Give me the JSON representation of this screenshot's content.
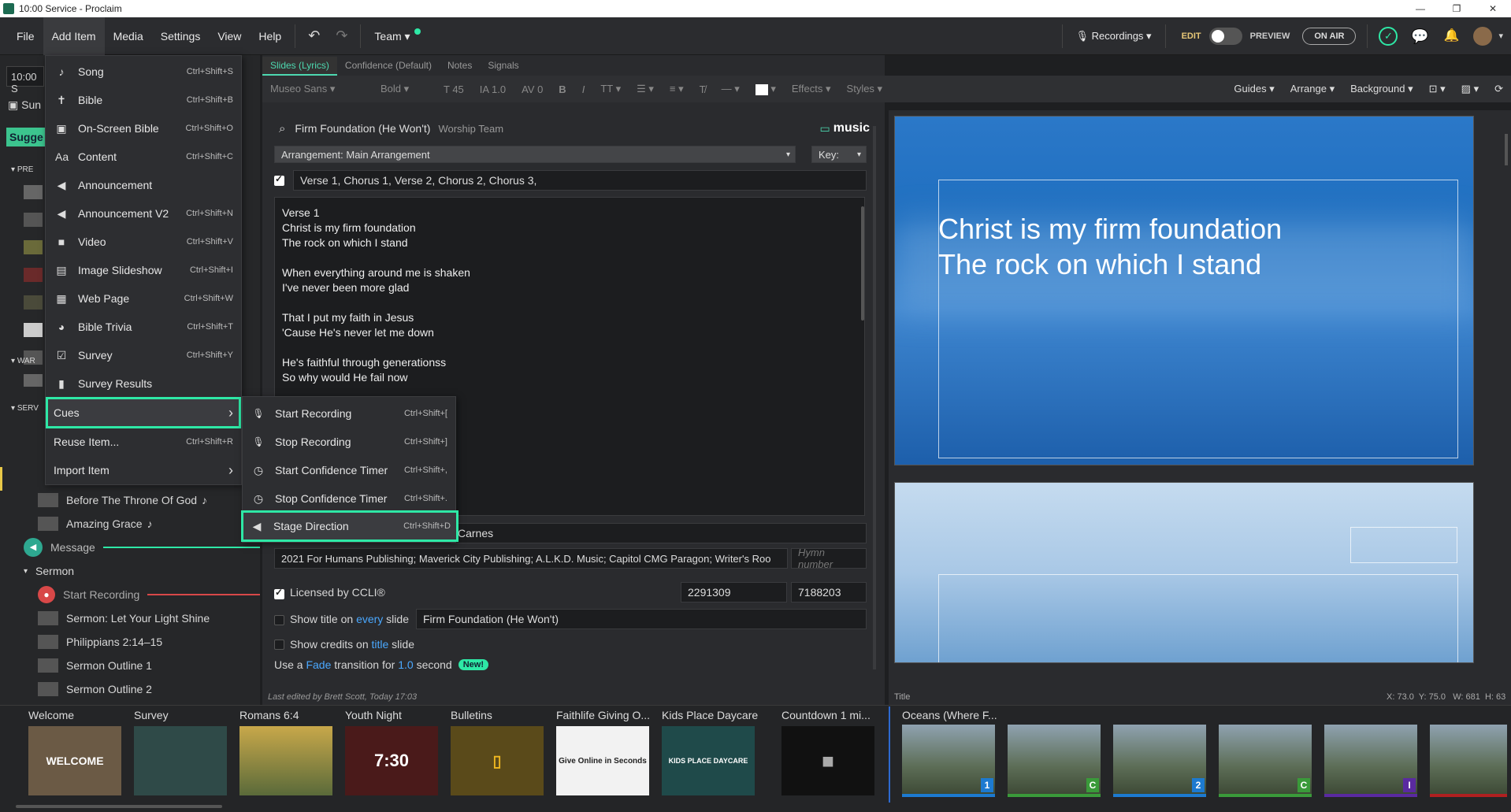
{
  "window": {
    "title": "10:00 Service - Proclaim"
  },
  "menubar": {
    "items": [
      "File",
      "Add Item",
      "Media",
      "Settings",
      "View",
      "Help"
    ],
    "team_label": "Team",
    "recordings_label": "Recordings",
    "edit_label": "EDIT",
    "preview_label": "PREVIEW",
    "on_air_label": "ON AIR"
  },
  "left_panel": {
    "service_label": "10:00 S",
    "sun_label": "Sun",
    "suggest_label": "Sugge",
    "pre_label": "PRE",
    "war_label": "WAR",
    "serv_label": "SERV",
    "items": [
      {
        "label": "Before The Throne Of God",
        "icon": "music-note-icon"
      },
      {
        "label": "Amazing Grace",
        "icon": "music-note-icon"
      },
      {
        "label": "Message",
        "icon": "announcement-icon"
      },
      {
        "label": "Sermon",
        "icon": "chevron-down-icon"
      },
      {
        "label": "Start Recording",
        "icon": "microphone-icon"
      },
      {
        "label": "Sermon: Let Your Light Shine",
        "icon": "slide-icon"
      },
      {
        "label": "Philippians 2:14–15",
        "icon": "slide-icon"
      },
      {
        "label": "Sermon Outline 1",
        "icon": "slide-icon"
      },
      {
        "label": "Sermon Outline 2",
        "icon": "slide-icon"
      }
    ]
  },
  "add_item_menu": [
    {
      "label": "Song",
      "shortcut": "Ctrl+Shift+S",
      "icon": "♪"
    },
    {
      "label": "Bible",
      "shortcut": "Ctrl+Shift+B",
      "icon": "✝"
    },
    {
      "label": "On-Screen Bible",
      "shortcut": "Ctrl+Shift+O",
      "icon": "▣"
    },
    {
      "label": "Content",
      "shortcut": "Ctrl+Shift+C",
      "icon": "Aa"
    },
    {
      "label": "Announcement",
      "shortcut": "",
      "icon": "◀"
    },
    {
      "label": "Announcement V2",
      "shortcut": "Ctrl+Shift+N",
      "icon": "◀"
    },
    {
      "label": "Video",
      "shortcut": "Ctrl+Shift+V",
      "icon": "■"
    },
    {
      "label": "Image Slideshow",
      "shortcut": "Ctrl+Shift+I",
      "icon": "▤"
    },
    {
      "label": "Web Page",
      "shortcut": "Ctrl+Shift+W",
      "icon": "▦"
    },
    {
      "label": "Bible Trivia",
      "shortcut": "Ctrl+Shift+T",
      "icon": "◕"
    },
    {
      "label": "Survey",
      "shortcut": "Ctrl+Shift+Y",
      "icon": "☑"
    },
    {
      "label": "Survey Results",
      "shortcut": "",
      "icon": "▮"
    },
    {
      "label": "Cues",
      "shortcut": "",
      "icon": ""
    },
    {
      "label": "Reuse Item...",
      "shortcut": "Ctrl+Shift+R",
      "icon": ""
    },
    {
      "label": "Import Item",
      "shortcut": "",
      "icon": ""
    }
  ],
  "cues_menu": [
    {
      "label": "Start Recording",
      "shortcut": "Ctrl+Shift+["
    },
    {
      "label": "Stop Recording",
      "shortcut": "Ctrl+Shift+]"
    },
    {
      "label": "Start Confidence Timer",
      "shortcut": "Ctrl+Shift+,"
    },
    {
      "label": "Stop Confidence Timer",
      "shortcut": "Ctrl+Shift+."
    },
    {
      "label": "Stage Direction",
      "shortcut": "Ctrl+Shift+D"
    }
  ],
  "editor": {
    "tabs": [
      "Slides (Lyrics)",
      "Confidence (Default)",
      "Notes",
      "Signals"
    ],
    "font_name": "Museo Sans",
    "font_weight": "Bold",
    "font_size": "45",
    "line_height": "1.0",
    "spacing": "0",
    "effects_label": "Effects",
    "styles_label": "Styles",
    "guides_label": "Guides",
    "arrange_label": "Arrange",
    "background_label": "Background",
    "song_title": "Firm Foundation (He Won't)",
    "song_artist": "Worship Team",
    "music_label": "music",
    "arrangement": "Arrangement: Main Arrangement",
    "key_label": "Key:",
    "sequence": "Verse 1, Chorus 1, Verse 2, Chorus 2, Chorus 3,",
    "lyrics": "Verse 1\nChrist is my firm foundation\nThe rock on which I stand\n\nWhen everything around me is shaken\nI've never been more glad\n\nThat I put my faith in Jesus\n'Cause He's never let me down\n\nHe's faithful through generationss\nSo why would He fail now",
    "authors_partial": "Carnes",
    "copyright": "2021 For Humans Publishing; Maverick City Publishing; A.L.K.D. Music; Capitol CMG Paragon; Writer's Roo",
    "hymn_placeholder": "Hymn number",
    "licensed_label": "Licensed by CCLI®",
    "ccli_number": "2291309",
    "song_number": "7188203",
    "show_title_prefix": "Show title on ",
    "show_title_every": "every",
    "show_title_suffix": " slide",
    "title_value": "Firm Foundation (He Won't)",
    "show_credits_prefix": "Show credits on ",
    "show_credits_title": "title",
    "show_credits_suffix": " slide",
    "transition_prefix": "Use a ",
    "transition_type": "Fade",
    "transition_mid": " transition for ",
    "transition_value": "1.0",
    "transition_suffix": " second",
    "new_badge": "New!",
    "last_edited": "Last edited by Brett Scott, Today 17:03"
  },
  "preview": {
    "slide_text": "Christ is my firm foundation\nThe rock on which I stand",
    "status_title": "Title",
    "status_coords": "X: 73.0  Y: 75.0   W: 681  H: 63"
  },
  "strip": {
    "items": [
      {
        "label": "Welcome",
        "thumb_text": "WELCOME",
        "color": "#6b5a45"
      },
      {
        "label": "Survey",
        "thumb_text": "",
        "color": "#2f4a48"
      },
      {
        "label": "Romans 6:4",
        "thumb_text": "",
        "color": "#8a7a3a"
      },
      {
        "label": "Youth Night",
        "thumb_text": "7:30",
        "color": "#4a1a1a"
      },
      {
        "label": "Bulletins",
        "thumb_text": "",
        "color": "#5a4a1a"
      },
      {
        "label": "Faithlife Giving O...",
        "thumb_text": "Give Online in Seconds",
        "color": "#f2f2f2"
      },
      {
        "label": "Kids Place Daycare",
        "thumb_text": "KIDS PLACE DAYCARE",
        "color": "#1f4a4a"
      },
      {
        "label": "Countdown 1 mi...",
        "thumb_text": "",
        "color": "#111111"
      }
    ],
    "song_label": "Oceans (Where F...",
    "song_badges": [
      "1",
      "C",
      "2",
      "C",
      "I",
      ""
    ],
    "song_badge_colors": [
      "#1d7ad0",
      "#3a9a3a",
      "#1d7ad0",
      "#3a9a3a",
      "#5a2aa0",
      "#b02020"
    ]
  },
  "colors": {
    "accent": "#2ee8a6",
    "link": "#4aa8ff"
  }
}
